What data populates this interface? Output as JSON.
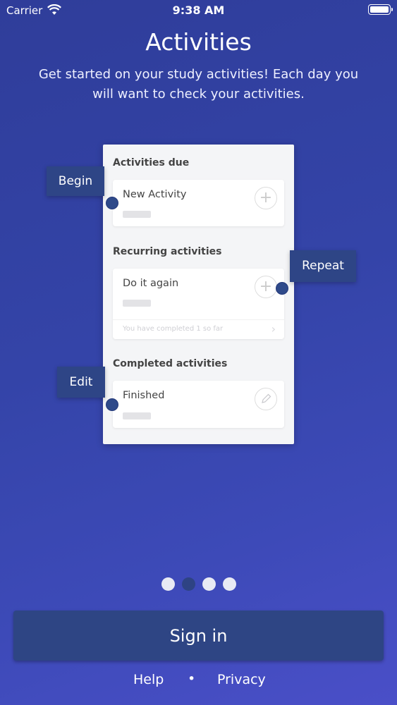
{
  "status_bar": {
    "carrier": "Carrier",
    "time": "9:38 AM"
  },
  "header": {
    "title": "Activities",
    "subtitle": "Get started on your study activities! Each day you will want to check your activities."
  },
  "card": {
    "sections": [
      {
        "heading": "Activities due",
        "item": "New Activity",
        "action_icon": "plus-icon"
      },
      {
        "heading": "Recurring activities",
        "item": "Do it again",
        "action_icon": "plus-icon",
        "sub_text": "You have completed 1 so far"
      },
      {
        "heading": "Completed activities",
        "item": "Finished",
        "action_icon": "pencil-icon"
      }
    ],
    "plus_glyph": "+",
    "chevron_glyph": "›"
  },
  "callouts": {
    "begin": "Begin",
    "repeat": "Repeat",
    "edit": "Edit"
  },
  "pager": {
    "total": 4,
    "active": 2
  },
  "actions": {
    "sign_in": "Sign in"
  },
  "footer": {
    "help": "Help",
    "separator": "•",
    "privacy": "Privacy"
  },
  "colors": {
    "background": "#3444a8",
    "button": "#2e4584",
    "callout": "#2e4586"
  }
}
